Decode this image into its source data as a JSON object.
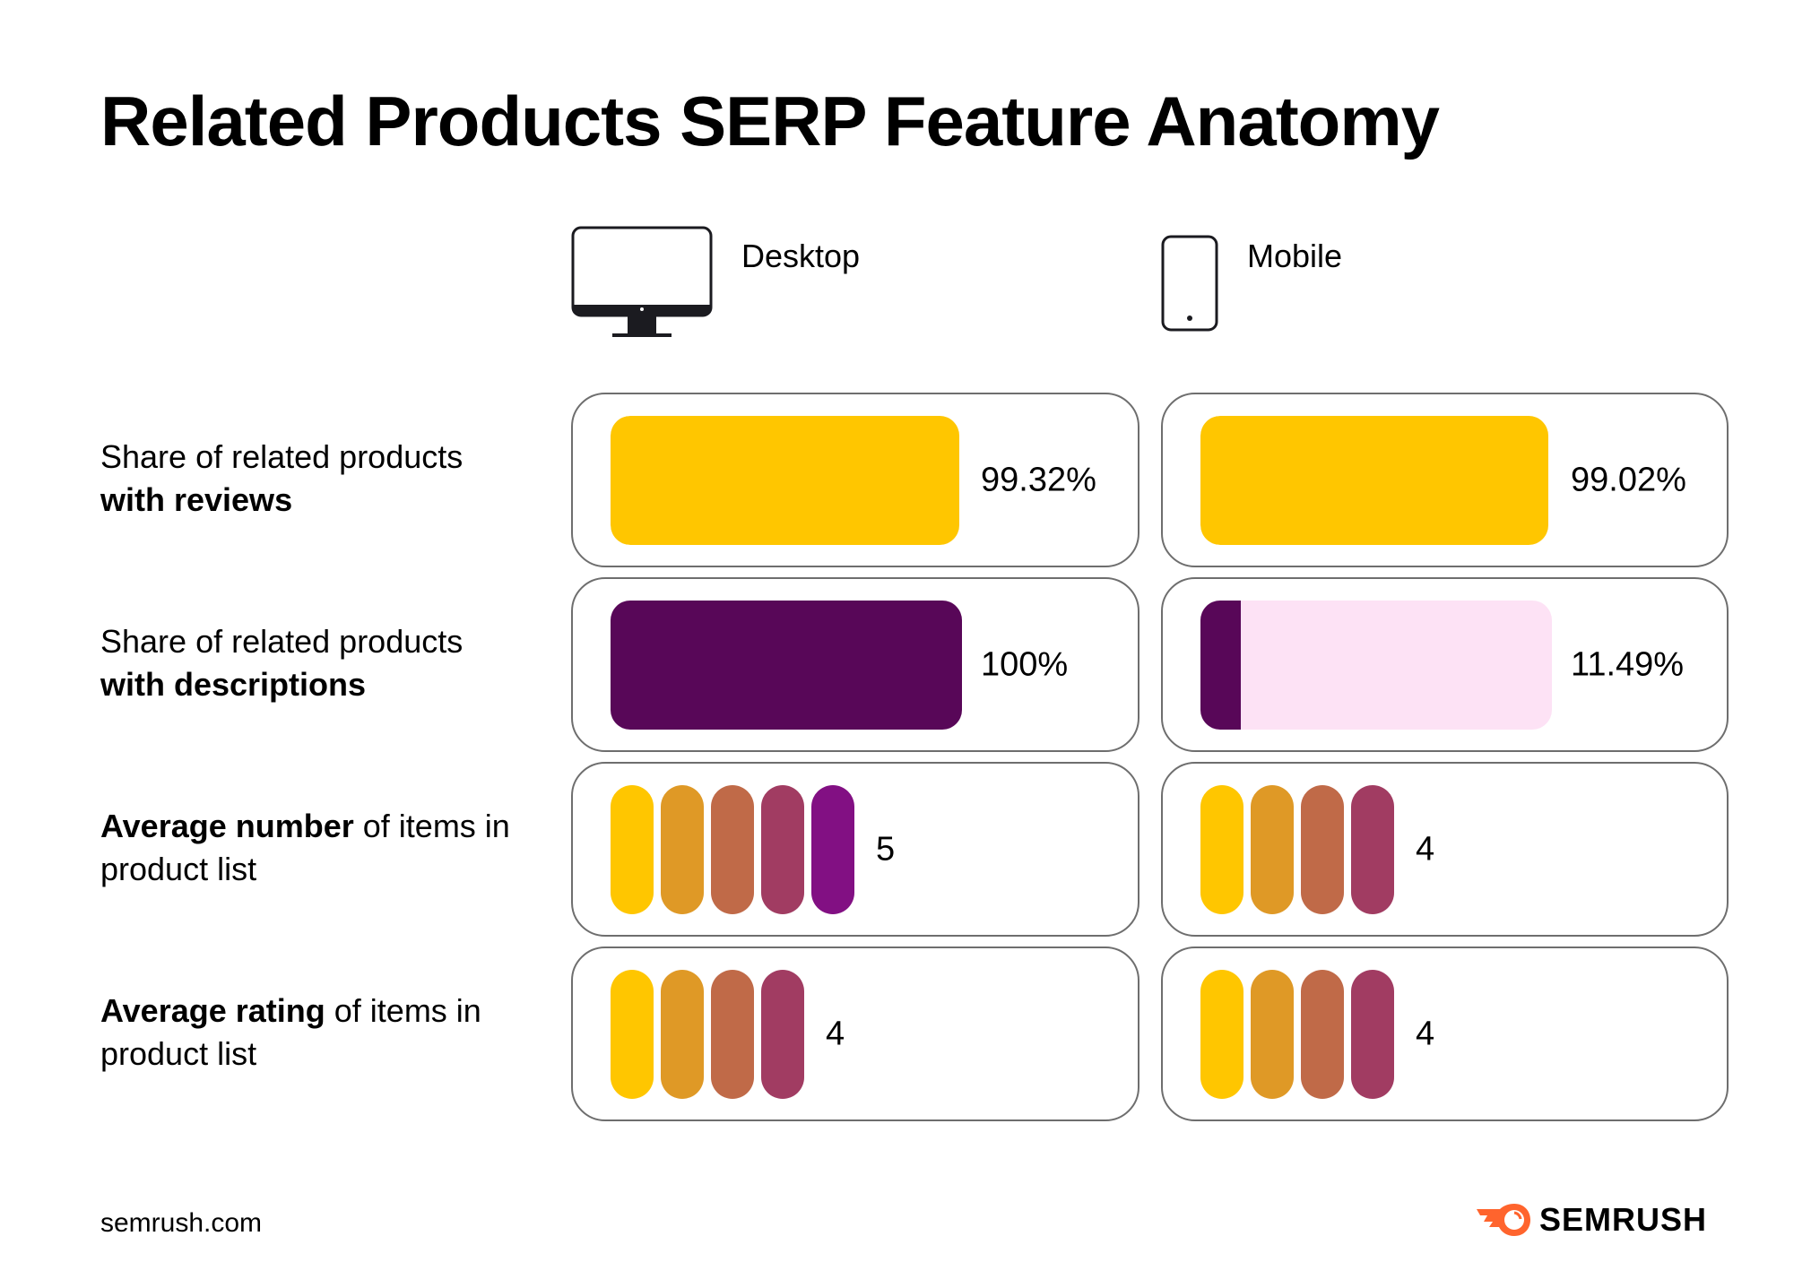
{
  "title": "Related Products SERP Feature Anatomy",
  "columns": [
    {
      "key": "desktop",
      "label": "Desktop",
      "icon": "desktop-monitor-icon"
    },
    {
      "key": "mobile",
      "label": "Mobile",
      "icon": "mobile-phone-icon"
    }
  ],
  "rows": [
    {
      "label_normal_1": "Share of related products ",
      "label_bold": "with reviews",
      "label_normal_2": "",
      "type": "percent_bar",
      "fill_color": "#FFC600",
      "track_color": "#FFC600",
      "desktop": {
        "value": 99.32,
        "display": "99.32%"
      },
      "mobile": {
        "value": 99.02,
        "display": "99.02%"
      }
    },
    {
      "label_normal_1": "Share of related products ",
      "label_bold": "with descriptions",
      "label_normal_2": "",
      "type": "percent_bar",
      "fill_color": "#580758",
      "track_color": "#FDE2F5",
      "desktop": {
        "value": 100,
        "display": "100%"
      },
      "mobile": {
        "value": 11.49,
        "display": "11.49%"
      }
    },
    {
      "label_normal_1": "",
      "label_bold": "Average number",
      "label_normal_2": " of items in product list",
      "type": "pill_count",
      "desktop": {
        "value": 5,
        "display": "5"
      },
      "mobile": {
        "value": 4,
        "display": "4"
      }
    },
    {
      "label_normal_1": "",
      "label_bold": "Average rating",
      "label_normal_2": " of items in product list",
      "type": "pill_count",
      "desktop": {
        "value": 4,
        "display": "4"
      },
      "mobile": {
        "value": 4,
        "display": "4"
      }
    }
  ],
  "pill_colors": [
    "#FFC600",
    "#DF9926",
    "#C06A48",
    "#A13C62",
    "#821083"
  ],
  "footer": {
    "url": "semrush.com",
    "brand": "SEMRUSH",
    "brand_color": "#FF642D"
  },
  "chart_data": {
    "type": "bar",
    "title": "Related Products SERP Feature Anatomy",
    "categories": [
      "Share of related products with reviews",
      "Share of related products with descriptions",
      "Average number of items in product list",
      "Average rating of items in product list"
    ],
    "series": [
      {
        "name": "Desktop",
        "values": [
          99.32,
          100,
          5,
          4
        ]
      },
      {
        "name": "Mobile",
        "values": [
          99.02,
          11.49,
          4,
          4
        ]
      }
    ],
    "units": [
      "%",
      "%",
      "items",
      "rating"
    ],
    "xlabel": "",
    "ylabel": ""
  }
}
